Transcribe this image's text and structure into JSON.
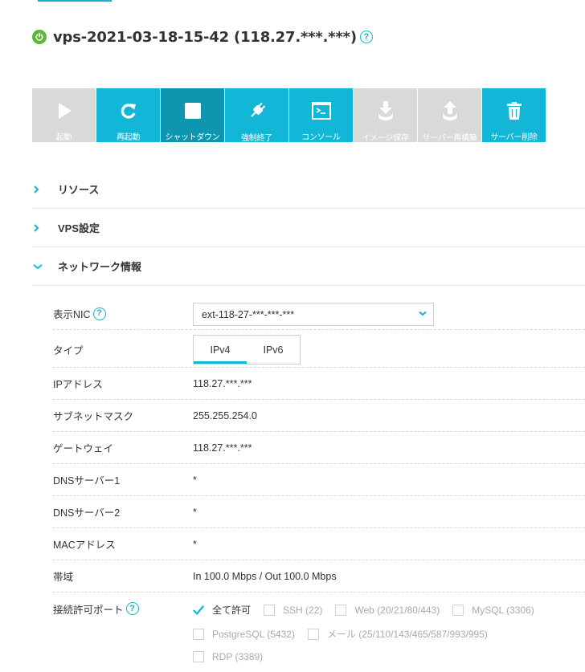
{
  "header": {
    "title": "vps-2021-03-18-15-42 (118.27.***.***)",
    "help": "?"
  },
  "toolbar": {
    "buttons": [
      {
        "label": "起動",
        "icon": "play-icon",
        "state": "disabled"
      },
      {
        "label": "再起動",
        "icon": "restart-icon",
        "state": "enabled"
      },
      {
        "label": "シャットダウン",
        "icon": "stop-icon",
        "state": "active"
      },
      {
        "label": "強制終了",
        "icon": "plug-icon",
        "state": "enabled"
      },
      {
        "label": "コンソール",
        "icon": "console-icon",
        "state": "enabled"
      },
      {
        "label": "イメージ保存",
        "icon": "download-icon",
        "state": "disabled"
      },
      {
        "label": "サーバー再構築",
        "icon": "upload-icon",
        "state": "disabled"
      },
      {
        "label": "サーバー削除",
        "icon": "trash-icon",
        "state": "enabled"
      }
    ]
  },
  "sections": {
    "resource": {
      "label": "リソース",
      "expanded": false
    },
    "vps_settings": {
      "label": "VPS設定",
      "expanded": false
    },
    "network": {
      "label": "ネットワーク情報",
      "expanded": true
    }
  },
  "network": {
    "nic_label": "表示NIC",
    "nic_value": "ext-118-27-***-***-***",
    "type_label": "タイプ",
    "tabs": [
      "IPv4",
      "IPv6"
    ],
    "active_tab": "IPv4",
    "ip_label": "IPアドレス",
    "ip_value": "118.27.***.***",
    "subnet_label": "サブネットマスク",
    "subnet_value": "255.255.254.0",
    "gateway_label": "ゲートウェイ",
    "gateway_value": "118.27.***.***",
    "dns1_label": "DNSサーバー1",
    "dns1_value": "*",
    "dns2_label": "DNSサーバー2",
    "dns2_value": "*",
    "mac_label": "MACアドレス",
    "mac_value": "*",
    "bandwidth_label": "帯域",
    "bandwidth_value": "In 100.0 Mbps / Out 100.0 Mbps",
    "ports_label": "接続許可ポート",
    "ports": [
      {
        "label": "全て許可",
        "checked": true
      },
      {
        "label": "SSH (22)",
        "checked": false
      },
      {
        "label": "Web (20/21/80/443)",
        "checked": false
      },
      {
        "label": "MySQL (3306)",
        "checked": false
      },
      {
        "label": "PostgreSQL (5432)",
        "checked": false
      },
      {
        "label": "メール (25/110/143/465/587/993/995)",
        "checked": false
      },
      {
        "label": "RDP (3389)",
        "checked": false
      }
    ]
  },
  "colors": {
    "accent": "#12b6d6",
    "active_button": "#0e96b0",
    "disabled_button": "#d9d9d9",
    "power_on": "#5cb830"
  }
}
